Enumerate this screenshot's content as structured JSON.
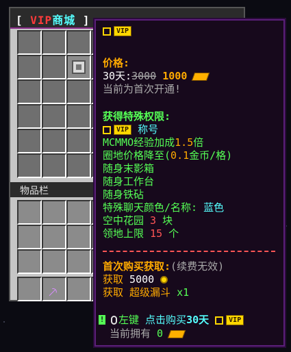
{
  "inventory": {
    "title_bracket_open": "[",
    "title_vip": "VIP",
    "title_shop": "商城",
    "title_bracket_close": "]",
    "section_label": "物品栏"
  },
  "tooltip": {
    "vip_badge": "VIP",
    "price_header": "价格:",
    "duration": "30天:",
    "old_price": "3000",
    "new_price": "1000",
    "first_open": "当前为首次开通!",
    "perks_header": "获得特殊权限:",
    "perk_title_suffix": "称号",
    "perk_mcmmo_prefix": "MCMMO经验加成",
    "perk_mcmmo_value": "1.5",
    "perk_mcmmo_suffix": "倍",
    "perk_land_prefix": "圈地价格降至(",
    "perk_land_value": "0.1",
    "perk_land_suffix": "金币/格)",
    "perk_enderchest": "随身末影箱",
    "perk_workbench": "随身工作台",
    "perk_anvil": "随身铁砧",
    "perk_chat_prefix": "特殊聊天颜色/名称:",
    "perk_chat_value": "蓝色",
    "perk_garden_prefix": "空中花园",
    "perk_garden_value": "3",
    "perk_garden_suffix": "块",
    "perk_claim_prefix": "领地上限",
    "perk_claim_value": "15",
    "perk_claim_suffix": "个",
    "first_buy_header": "首次购买获取:",
    "first_buy_note": "(续费无效)",
    "reward1_label": "获取",
    "reward1_value": "5000",
    "reward2_label": "获取",
    "reward2_item": "超级漏斗",
    "reward2_count": "x1",
    "action_hint_mark": "!",
    "action_click": "左键",
    "action_text": "点击购买",
    "action_duration": "30天",
    "owned_label": "当前拥有",
    "owned_value": "0"
  }
}
